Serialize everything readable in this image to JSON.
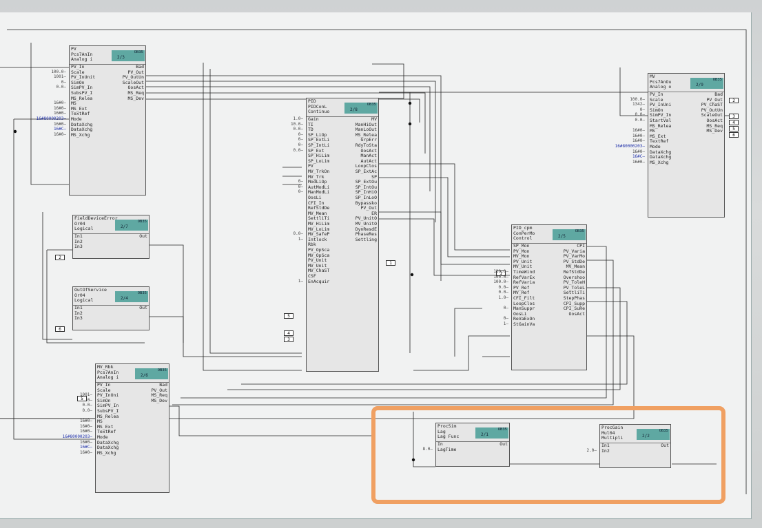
{
  "blocks": {
    "pv": {
      "lines": [
        "PV",
        "Pcs7AnIn",
        "Analog i"
      ],
      "ob": "OB35",
      "num": "2/3",
      "inputs": [
        "PV_In",
        "Scale",
        "PV_InUnit",
        "SimOn",
        "SimPV_In",
        "SubsPV_I",
        "MS_Relea",
        "MS",
        "MS_Ext",
        "TextRef",
        "Mode",
        "DataXchg",
        "DataXchg",
        "MS_Xchg"
      ],
      "outputs": [
        "Bad",
        "PV_Out",
        "PV_OutUn",
        "ScaleOut",
        "OosAct",
        "MS_Req",
        "MS_Dev"
      ],
      "params": [
        "",
        "100.0",
        "1001",
        "0",
        "0.0",
        "",
        "",
        "16#0",
        "16#0",
        "16#0",
        "16#80000203",
        "16#0",
        "16#C",
        "16#0"
      ]
    },
    "pid": {
      "lines": [
        "PID",
        "PIDConL",
        "Continuo"
      ],
      "ob": "OB35",
      "num": "2/8",
      "inputs": [
        "Gain",
        "TI",
        "TD",
        "SP_LiOp",
        "SP_ExtLi",
        "SP_IntLi",
        "SP_Ext",
        "SP_HiLim",
        "SP_LoLim",
        "PV",
        "MV_TrkOn",
        "MV_Trk",
        "ModLiOp",
        "AutModLi",
        "ManModLi",
        "OosLi",
        "CFI_In",
        "RefStdDe",
        "MV_Mean",
        "SettliTi",
        "MV_HiLim",
        "MV_LoLim",
        "MV_SafeP",
        "Intlock",
        "Rbk",
        "PV_OpSca",
        "MV_OpSca",
        "PV_Unit",
        "MV_Unit",
        "MV_ChaST",
        "CSF",
        "EnAcquir"
      ],
      "outputs": [
        "MV",
        "ManHiOut",
        "ManLoOut",
        "MS_Relea",
        "GrpErr",
        "RdyToSta",
        "OosAct",
        "ManAct",
        "AutAct",
        "LoopClos",
        "SP_ExtAc",
        "SP",
        "SP_ExtOu",
        "SP_IntOu",
        "SP_InHiO",
        "SP_InLoO",
        "Bypassko",
        "PV_Out",
        "ER",
        "PV_UnitO",
        "MV_UnitO",
        "DynResdE",
        "PhaseRes",
        "Settling"
      ],
      "params": [
        "1.0",
        "10.0",
        "0.0",
        "0",
        "0",
        "0",
        "0.0",
        "",
        "",
        "",
        "",
        "",
        "0",
        "0",
        "0",
        "",
        "",
        "",
        "",
        "",
        "",
        "",
        "0.0",
        "1",
        "",
        "",
        "",
        "",
        "",
        "",
        "",
        "1"
      ]
    },
    "mv": {
      "lines": [
        "MV",
        "Pcs7AnOu",
        "Analog o"
      ],
      "ob": "OB35",
      "num": "2/9",
      "inputs": [
        "PV_In",
        "Scale",
        "PV_InUni",
        "SimOn",
        "SimPV_In",
        "StartVal",
        "MS_Relea",
        "MS",
        "MS_Ext",
        "TextRef",
        "Mode",
        "DataXchg",
        "DataXchg",
        "MS_Xchg"
      ],
      "outputs": [
        "Bad",
        "PV_Out",
        "PV_ChaST",
        "PV_OutUn",
        "ScaleOut",
        "OosAct",
        "MS_Req",
        "MS_Dev"
      ],
      "params": [
        "",
        "100.0",
        "1342",
        "0",
        "0.0",
        "0.0",
        "",
        "16#0",
        "16#0",
        "16#0",
        "16#80000203",
        "16#0",
        "16#C",
        "16#0"
      ]
    },
    "fde": {
      "lines": [
        "FieldDeviceError",
        "Or04",
        "Logical"
      ],
      "ob": "OB35",
      "num": "2/7",
      "inputs": [
        "In1",
        "In2",
        "In3"
      ],
      "outputs": [
        "Out"
      ],
      "params": [
        "",
        "",
        ""
      ]
    },
    "ods": {
      "lines": [
        "OutOfService",
        "Or04",
        "Logical"
      ],
      "ob": "OB35",
      "num": "2/4",
      "inputs": [
        "In1",
        "In2",
        "In3"
      ],
      "outputs": [
        "Out"
      ],
      "params": [
        "",
        "",
        ""
      ]
    },
    "mvrbk": {
      "lines": [
        "MV_Rbk",
        "Pcs7AnIn",
        "Analog i"
      ],
      "ob": "OB35",
      "num": "2/6",
      "inputs": [
        "PV_In",
        "Scale",
        "PV_InUni",
        "SimOn",
        "SimPV_In",
        "SubsPV_I",
        "MS_Relea",
        "MS",
        "MS_Ext",
        "TextRef",
        "Mode",
        "DataXchg",
        "DataXchg",
        "MS_Xchg"
      ],
      "outputs": [
        "Bad",
        "PV_Out",
        "MS_Req",
        "MS_Dev"
      ],
      "params": [
        "",
        "",
        "1001",
        "0",
        "0.0",
        "0.0",
        "",
        "16#0",
        "16#0",
        "16#0",
        "16#80000203",
        "16#0",
        "16#C",
        "16#0"
      ]
    },
    "cpm": {
      "lines": [
        "PID_cpm",
        "ConPerMo",
        "Control"
      ],
      "ob": "OB35",
      "num": "2/5",
      "inputs": [
        "SP_Mon",
        "PV_Mon",
        "MV_Mon",
        "PV_Unit",
        "MV_Unit",
        "TimeWind",
        "RefVarEx",
        "RefVaria",
        "PV_Ref",
        "MV_Ref",
        "CFI_Filt",
        "LoopClos",
        "ManSuppr",
        "OosLi",
        "ReVaExOn",
        "StGainVa"
      ],
      "outputs": [
        "CPI",
        "PV_Varia",
        "PV_VarMo",
        "PV_StdDe",
        "MV_Mean",
        "RefStdDe",
        "Overshoo",
        "PV_ToleH",
        "PV_ToleL",
        "SettliTi",
        "StepPhas",
        "CPI_Supp",
        "CPI_SuRe",
        "OosAct"
      ],
      "params": [
        "",
        "",
        "",
        "",
        "",
        "120.0",
        "100.0",
        "100.0",
        "0.0",
        "0.0",
        "1.0",
        "",
        "0",
        "",
        "0",
        "1"
      ]
    },
    "lag": {
      "lines": [
        "ProcSim",
        "Lag",
        "Lag Func"
      ],
      "ob": "OB35",
      "num": "2/1",
      "inputs": [
        "In",
        "LagTime"
      ],
      "outputs": [
        "Out"
      ],
      "params": [
        "",
        "8.0"
      ]
    },
    "gain": {
      "lines": [
        "ProcGain",
        "Mul04",
        "Multipli"
      ],
      "ob": "OB35",
      "num": "2/2",
      "inputs": [
        "In1",
        "In2"
      ],
      "outputs": [
        "Out"
      ],
      "params": [
        "",
        "2.0"
      ]
    }
  },
  "ports": {
    "fde_in3": "2",
    "ods_in3": "6",
    "rbk_scale": "5",
    "pid_pvopsca": "5",
    "pid_pvunit": "4",
    "pid_mvunit": "3",
    "pid_pvunito": "1",
    "cpm_pvunit": "1",
    "mv_bad": "2",
    "mv_chast": "3",
    "mv_outun": "4",
    "mv_scaleout": "5",
    "mv_oosact": "6"
  },
  "colors": {
    "block_tag": "#5fa8a2",
    "highlight": "#f0a062"
  }
}
